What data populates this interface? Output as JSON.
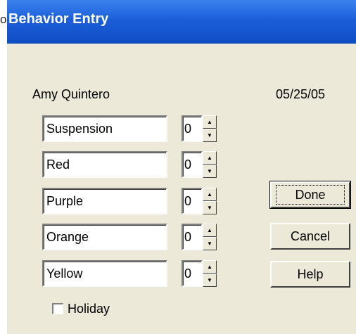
{
  "window": {
    "title": "Behavior Entry",
    "title_cut_glyph": "o"
  },
  "header": {
    "student_name": "Amy Quintero",
    "date": "05/25/05"
  },
  "behaviors": [
    {
      "label": "Suspension",
      "count": "0"
    },
    {
      "label": "Red",
      "count": "0"
    },
    {
      "label": "Purple",
      "count": "0"
    },
    {
      "label": "Orange",
      "count": "0"
    },
    {
      "label": "Yellow",
      "count": "0"
    }
  ],
  "buttons": {
    "done": "Done",
    "cancel": "Cancel",
    "help": "Help"
  },
  "holiday": {
    "label": "Holiday",
    "checked": false
  },
  "icons": {
    "spin_up": "arrow-up-icon",
    "spin_down": "arrow-down-icon"
  },
  "colors": {
    "titlebar": "#1b5fd8",
    "dialog_bg": "#ece9d8"
  }
}
